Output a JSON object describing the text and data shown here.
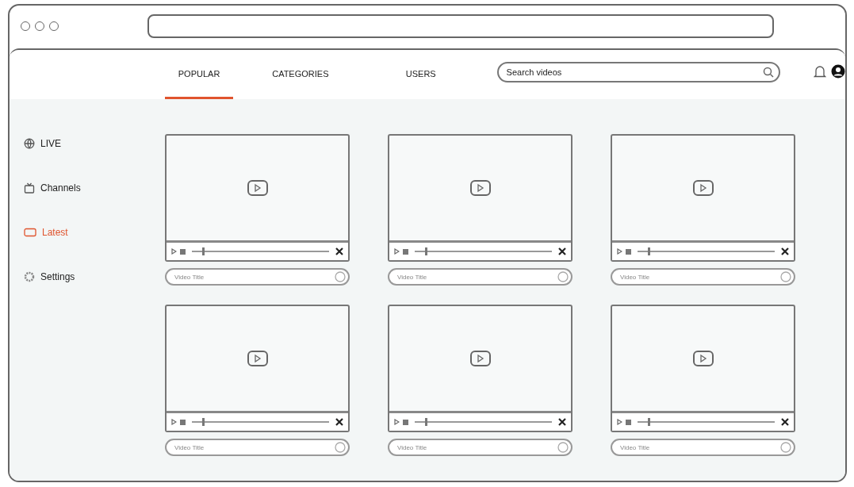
{
  "nav": {
    "tabs": [
      {
        "label": "POPULAR",
        "selected": true
      },
      {
        "label": "CATEGORIES",
        "selected": false
      },
      {
        "label": "USERS",
        "selected": false
      }
    ],
    "search": {
      "placeholder": "Search videos"
    }
  },
  "sidebar": {
    "items": [
      {
        "label": "LIVE",
        "kind": "live",
        "selected": false
      },
      {
        "label": "Channels",
        "kind": "channels",
        "selected": false
      },
      {
        "label": "Latest",
        "kind": "latest",
        "selected": true
      },
      {
        "label": "Settings",
        "kind": "settings",
        "selected": false
      }
    ]
  },
  "videos": [
    {
      "title_placeholder": "Video Title",
      "level": 0.08
    },
    {
      "title_placeholder": "Video Title",
      "level": 0.08
    },
    {
      "title_placeholder": "Video Title",
      "level": 0.08
    },
    {
      "title_placeholder": "Video Title",
      "level": 0.08
    },
    {
      "title_placeholder": "Video Title",
      "level": 0.08
    },
    {
      "title_placeholder": "Video Title",
      "level": 0.08
    }
  ]
}
